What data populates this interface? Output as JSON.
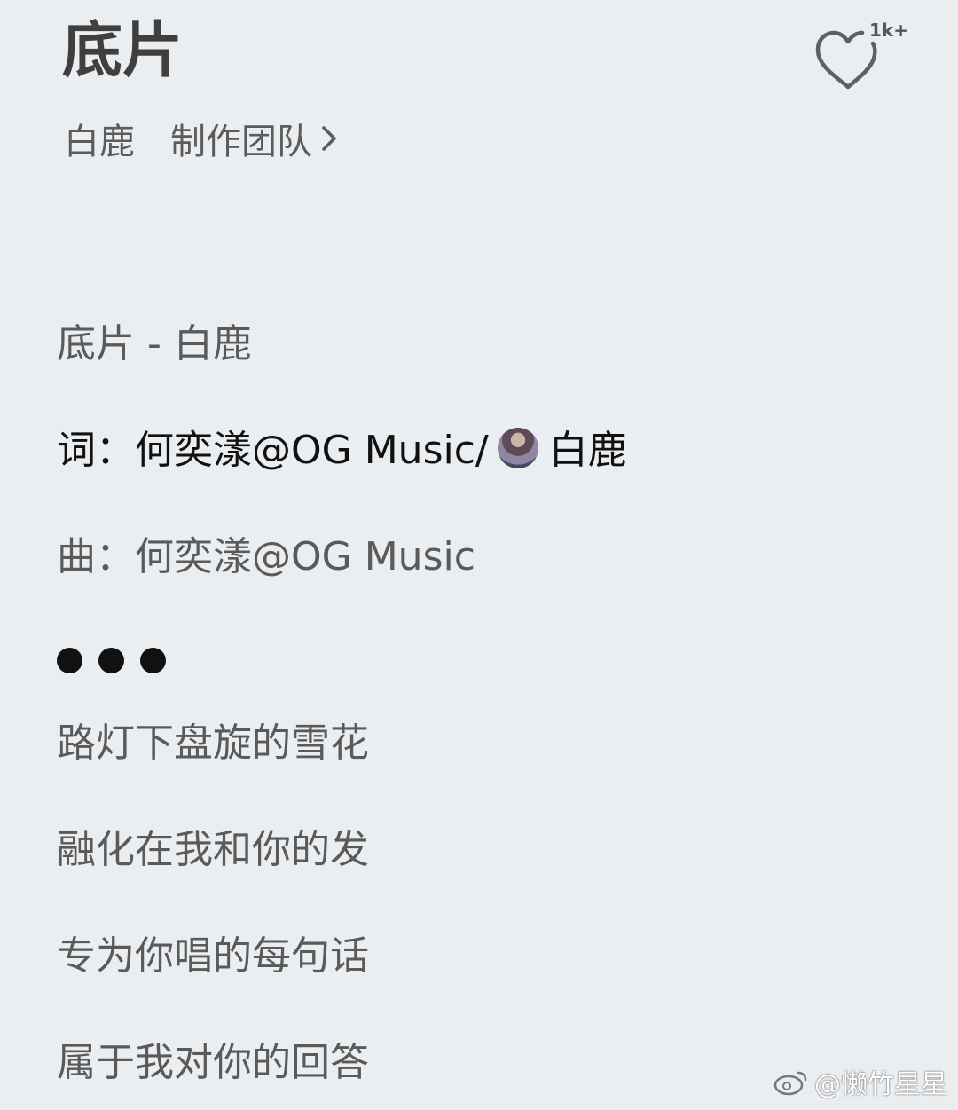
{
  "header": {
    "title": "底片",
    "like_count": "1k+",
    "artist": "白鹿",
    "team_label": "制作团队"
  },
  "lyrics": {
    "heading": "底片 - 白鹿",
    "lyricist_prefix": "词：何奕漾@OG Music/",
    "lyricist_name": "白鹿",
    "composer": "曲：何奕漾@OG Music",
    "lines": [
      "路灯下盘旋的雪花",
      "融化在我和你的发",
      "专为你唱的每句话",
      "属于我对你的回答"
    ]
  },
  "watermark": {
    "text": "@懒竹星星"
  },
  "icons": {
    "like": "heart-icon",
    "team_arrow": "chevron-right-icon",
    "dots": "ellipsis-icon",
    "watermark": "weibo-logo-icon"
  }
}
